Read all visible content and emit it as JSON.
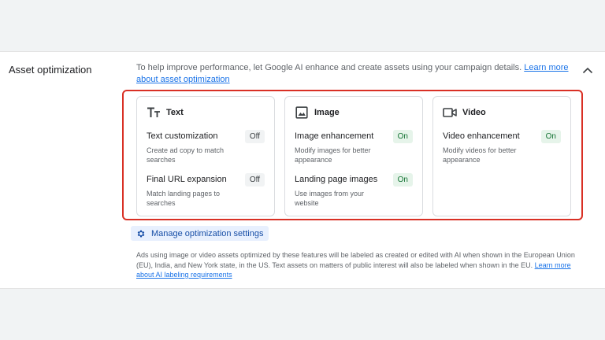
{
  "section": {
    "title": "Asset optimization",
    "description": "To help improve performance, let Google AI enhance and create assets using your campaign details.",
    "learn_more": "Learn more about asset optimization"
  },
  "icons": {
    "collapse": "chevron-up-icon",
    "text": "text-format-icon",
    "image": "image-icon",
    "video": "videocam-icon",
    "manage": "gear-icon"
  },
  "colors": {
    "link": "#1a73e8",
    "highlight": "#d93025",
    "on_chip_bg": "#e6f4ea",
    "on_chip_text": "#137333",
    "off_chip_bg": "#f1f3f4"
  },
  "cards": {
    "text": {
      "title": "Text",
      "features": [
        {
          "name": "Text customization",
          "desc": "Create ad copy to match searches",
          "status": "Off"
        },
        {
          "name": "Final URL expansion",
          "desc": "Match landing pages to searches",
          "status": "Off"
        }
      ]
    },
    "image": {
      "title": "Image",
      "features": [
        {
          "name": "Image enhancement",
          "desc": "Modify images for better appearance",
          "status": "On"
        },
        {
          "name": "Landing page images",
          "desc": "Use images from your website",
          "status": "On"
        }
      ]
    },
    "video": {
      "title": "Video",
      "features": [
        {
          "name": "Video enhancement",
          "desc": "Modify videos for better appearance",
          "status": "On"
        }
      ]
    }
  },
  "manage_button": "Manage optimization settings",
  "footnote": {
    "text": "Ads using image or video assets optimized by these features will be labeled as created or edited with AI when shown in the European Union (EU), India, and New York state, in the US. Text assets on matters of public interest will also be labeled when shown in the EU.",
    "link": "Learn more about AI labeling requirements"
  }
}
